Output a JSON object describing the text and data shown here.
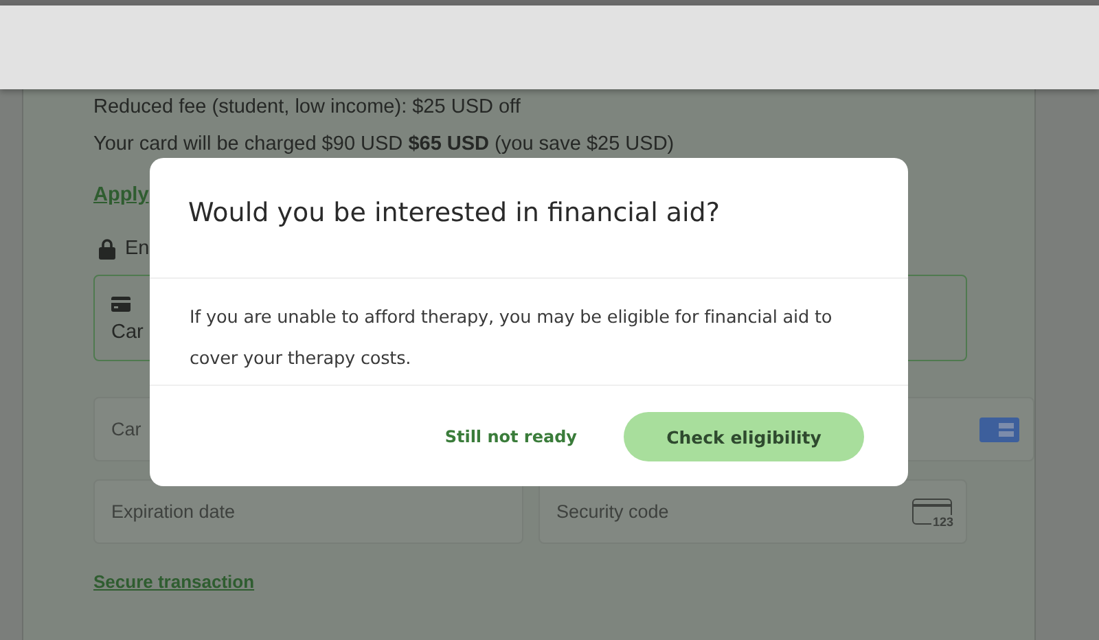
{
  "summary": {
    "fee_line": "Reduced fee (student, low income): $25 USD off",
    "charge_line": "Your card will be charged $90 USD **$65 USD** (you save $25 USD)",
    "apply_link": "Apply"
  },
  "encryption_note": "En",
  "payment_option": {
    "label": "Car",
    "selected": true
  },
  "fields": [
    {
      "kind": "card",
      "placeholder": "Car"
    },
    {
      "kind": "expiry",
      "placeholder": "Expiration date"
    },
    {
      "kind": "cvc",
      "placeholder": "Security code",
      "icon_label": "123"
    }
  ],
  "secure_link": "Secure transaction",
  "dialog": {
    "title": "Would you be interested in financial aid?",
    "message": "If you are unable to afford therapy, you may be eligible for financial aid to cover your therapy costs.",
    "buttons": [
      {
        "kind": "text",
        "label": "Still not ready"
      },
      {
        "kind": "primary",
        "label": "Check eligibility"
      }
    ]
  }
}
